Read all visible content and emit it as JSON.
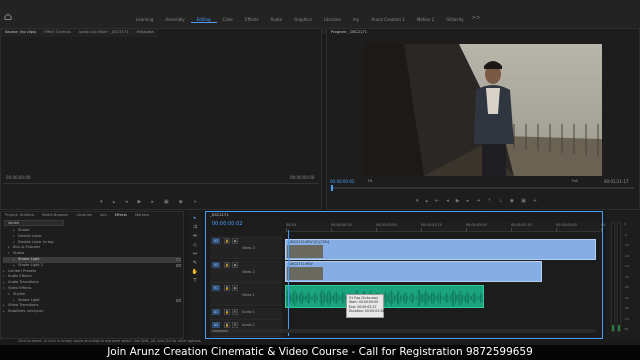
{
  "workspace": {
    "tabs": [
      "Learning",
      "Assembly",
      "Editing",
      "Color",
      "Effects",
      "Audio",
      "Graphics",
      "Libraries",
      "my",
      "Arunz Creation 1",
      "Motion 2",
      "Gifsocity"
    ],
    "active_tab": "Editing",
    "more": ">>"
  },
  "source_panel": {
    "tabs": [
      "Source: (no clips)",
      "Effect Controls",
      "Audio Clip Mixer: _DSC2171",
      "Metadata"
    ],
    "timecode_left": "00:00:00:00",
    "timecode_right": "00:00:00:00"
  },
  "program_panel": {
    "title": "Program: _DSC2171",
    "timecode_left": "00:00:00:02",
    "fit": "Fit",
    "resolution": "Full",
    "timecode_right": "00:01:21:17"
  },
  "project_panel": {
    "tabs": [
      "Project: Untitled",
      "Media Browser",
      "Libraries",
      "Info",
      "Effects",
      "Markers"
    ],
    "active_tab": "Effects",
    "search_value": "stroke",
    "tree": [
      {
        "label": "Stroke",
        "indent": 2,
        "expanded": false,
        "badge": false
      },
      {
        "label": "Double Layer",
        "indent": 2,
        "expanded": false,
        "badge": false
      },
      {
        "label": "Double Layer to top",
        "indent": 2,
        "expanded": false,
        "badge": false
      },
      {
        "label": "Blur & Sharpen",
        "indent": 1,
        "expanded": false,
        "badge": false
      },
      {
        "label": "Stroke",
        "indent": 1,
        "expanded": true,
        "badge": false
      },
      {
        "label": "Stroke Light",
        "indent": 2,
        "expanded": false,
        "badge": true,
        "selected": true
      },
      {
        "label": "Stroke Light 2",
        "indent": 2,
        "expanded": false,
        "badge": true
      },
      {
        "label": "Lumetri Presets",
        "indent": 0,
        "expanded": false,
        "badge": false
      },
      {
        "label": "Audio Effects",
        "indent": 0,
        "expanded": false,
        "badge": false
      },
      {
        "label": "Audio Transitions",
        "indent": 0,
        "expanded": false,
        "badge": false
      },
      {
        "label": "Video Effects",
        "indent": 0,
        "expanded": true,
        "badge": false
      },
      {
        "label": "Stylize",
        "indent": 1,
        "expanded": true,
        "badge": false
      },
      {
        "label": "Stroke Light",
        "indent": 2,
        "expanded": false,
        "badge": true
      },
      {
        "label": "Video Transitions",
        "indent": 0,
        "expanded": false,
        "badge": false
      },
      {
        "label": "Stabilizes, sectycon",
        "indent": 0,
        "expanded": false,
        "badge": false
      }
    ]
  },
  "timeline": {
    "tab": "_DSC2171",
    "timecode": "00:00:00:02",
    "ruler_labels": [
      "00:00",
      "00:00:00:15",
      "00:00:01:00",
      "00:00:01:15",
      "00:00:02:00",
      "00:00:02:15",
      "00:00:03:00",
      "00:00:03:15"
    ],
    "tracks": [
      {
        "id": "V3",
        "label": "Video 3",
        "kind": "video"
      },
      {
        "id": "V2",
        "label": "Video 2",
        "kind": "video"
      },
      {
        "id": "V1",
        "label": "Video 1",
        "kind": "video"
      },
      {
        "id": "A1",
        "label": "Audio 1",
        "kind": "audio"
      },
      {
        "id": "A2",
        "label": "Audio 2",
        "kind": "audio"
      },
      {
        "id": "A3",
        "label": "Audio 3",
        "kind": "audio"
      }
    ],
    "clips": {
      "v3": "_DSC2171.MOV [V] [75%]",
      "v2": "_DSC2171.MOV"
    },
    "tooltip": {
      "line1": "V1 Exp Clicks.wav",
      "line2": "Start: 00:00:00:00",
      "line3": "End: 00:00:02:27",
      "line4": "Duration: 00:00:02:28"
    }
  },
  "meter": {
    "labels": [
      "0",
      "-6",
      "-12",
      "-18",
      "-24",
      "-30",
      "-36",
      "-42",
      "-48",
      "-54",
      "dB"
    ]
  },
  "status_text": "Click to select, or click in empty space and drag to marquee select. Use Shift, Alt, and Ctrl for other options.",
  "banner": "Join Arunz Creation Cinematic & Video Course - Call for Registration 9872599659",
  "colors": {
    "accent": "#4a9cf6",
    "video_clip": "#86aee4",
    "audio_clip": "#1ba57f",
    "background": "#1a1a1a"
  }
}
